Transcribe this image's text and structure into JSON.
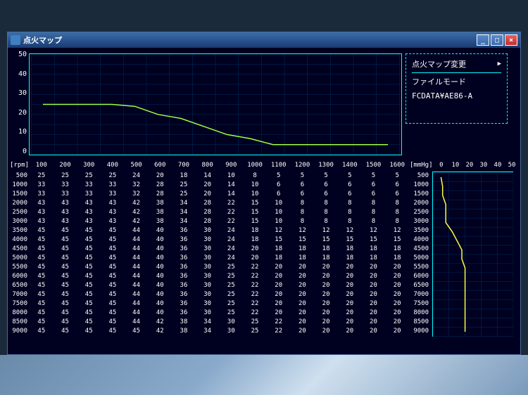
{
  "window": {
    "title": "点火マップ"
  },
  "info": {
    "change_label": "点火マップ変更",
    "mode_label": "ファイルモード",
    "file_name": "FCDATA¥AE86-A"
  },
  "chart_data": {
    "type": "line",
    "title": "",
    "xlabel": "rpm",
    "ylabel": "",
    "ylim": [
      0,
      50
    ],
    "yticks": [
      0,
      10,
      20,
      30,
      40,
      50
    ],
    "x": [
      100,
      200,
      300,
      400,
      500,
      600,
      700,
      800,
      900,
      1000,
      1100,
      1200,
      1300,
      1400,
      1500,
      1600
    ],
    "values": [
      25,
      25,
      25,
      25,
      24,
      20,
      18,
      14,
      10,
      8,
      5,
      5,
      5,
      5,
      5,
      5
    ]
  },
  "side_chart": {
    "type": "line",
    "xlabel": "mmHg",
    "xticks": [
      0,
      10,
      20,
      30,
      40,
      50
    ],
    "rpm": [
      500,
      1000,
      1500,
      2000,
      2500,
      3000,
      3500,
      4000,
      4500,
      5000,
      5500,
      6000,
      6500,
      7000,
      7500,
      8000,
      8500,
      9000
    ],
    "values": [
      5,
      6,
      6,
      8,
      8,
      8,
      12,
      15,
      18,
      18,
      20,
      20,
      20,
      20,
      20,
      20,
      20,
      20
    ]
  },
  "table": {
    "row_label": "[rpm]",
    "col_label": "[mmHg]",
    "cols": [
      100,
      200,
      300,
      400,
      500,
      600,
      700,
      800,
      900,
      1000,
      1100,
      1200,
      1300,
      1400,
      1500,
      1600
    ],
    "rows": [
      500,
      1000,
      1500,
      2000,
      2500,
      3000,
      3500,
      4000,
      4500,
      5000,
      5500,
      6000,
      6500,
      7000,
      7500,
      8000,
      8500,
      9000
    ],
    "cells": [
      [
        25,
        25,
        25,
        25,
        24,
        20,
        18,
        14,
        10,
        8,
        5,
        5,
        5,
        5,
        5,
        5
      ],
      [
        33,
        33,
        33,
        33,
        32,
        28,
        25,
        20,
        14,
        10,
        6,
        6,
        6,
        6,
        6,
        6
      ],
      [
        33,
        33,
        33,
        33,
        32,
        28,
        25,
        20,
        14,
        10,
        6,
        6,
        6,
        6,
        6,
        6
      ],
      [
        43,
        43,
        43,
        43,
        42,
        38,
        34,
        28,
        22,
        15,
        10,
        8,
        8,
        8,
        8,
        8
      ],
      [
        43,
        43,
        43,
        43,
        42,
        38,
        34,
        28,
        22,
        15,
        10,
        8,
        8,
        8,
        8,
        8
      ],
      [
        43,
        43,
        43,
        43,
        42,
        38,
        34,
        28,
        22,
        15,
        10,
        8,
        8,
        8,
        8,
        8
      ],
      [
        45,
        45,
        45,
        45,
        44,
        40,
        36,
        30,
        24,
        18,
        12,
        12,
        12,
        12,
        12,
        12
      ],
      [
        45,
        45,
        45,
        45,
        44,
        40,
        36,
        30,
        24,
        18,
        15,
        15,
        15,
        15,
        15,
        15
      ],
      [
        45,
        45,
        45,
        45,
        44,
        40,
        36,
        30,
        24,
        20,
        18,
        18,
        18,
        18,
        18,
        18
      ],
      [
        45,
        45,
        45,
        45,
        44,
        40,
        36,
        30,
        24,
        20,
        18,
        18,
        18,
        18,
        18,
        18
      ],
      [
        45,
        45,
        45,
        45,
        44,
        40,
        36,
        30,
        25,
        22,
        20,
        20,
        20,
        20,
        20,
        20
      ],
      [
        45,
        45,
        45,
        45,
        44,
        40,
        36,
        30,
        25,
        22,
        20,
        20,
        20,
        20,
        20,
        20
      ],
      [
        45,
        45,
        45,
        45,
        44,
        40,
        36,
        30,
        25,
        22,
        20,
        20,
        20,
        20,
        20,
        20
      ],
      [
        45,
        45,
        45,
        45,
        44,
        40,
        36,
        30,
        25,
        22,
        20,
        20,
        20,
        20,
        20,
        20
      ],
      [
        45,
        45,
        45,
        45,
        44,
        40,
        36,
        30,
        25,
        22,
        20,
        20,
        20,
        20,
        20,
        20
      ],
      [
        45,
        45,
        45,
        45,
        44,
        40,
        36,
        30,
        25,
        22,
        20,
        20,
        20,
        20,
        20,
        20
      ],
      [
        45,
        45,
        45,
        45,
        44,
        42,
        38,
        34,
        30,
        25,
        22,
        20,
        20,
        20,
        20,
        20
      ],
      [
        45,
        45,
        45,
        45,
        45,
        42,
        38,
        34,
        30,
        25,
        22,
        20,
        20,
        20,
        20,
        20
      ]
    ]
  }
}
